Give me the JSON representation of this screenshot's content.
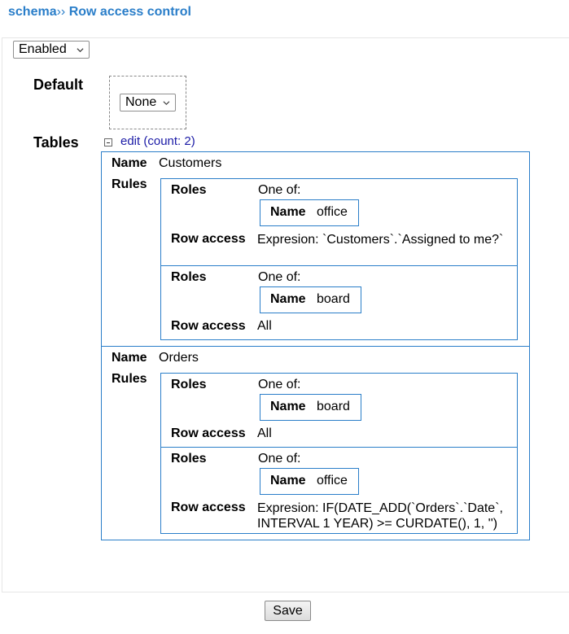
{
  "breadcrumb": {
    "root": "schema",
    "separator": "››",
    "current": "Row access control"
  },
  "status_select": {
    "value": "Enabled"
  },
  "default": {
    "label": "Default",
    "value": "None"
  },
  "tables": {
    "label": "Tables",
    "edit_label": "edit (count: 2)",
    "name_label": "Name",
    "rules_label": "Rules",
    "roles_label": "Roles",
    "row_access_label": "Row access",
    "one_of": "One of:",
    "items": [
      {
        "name": "Customers",
        "rules": [
          {
            "role_name": "office",
            "row_access": "Expresion: `Customers`.`Assigned to me?`"
          },
          {
            "role_name": "board",
            "row_access": "All"
          }
        ]
      },
      {
        "name": "Orders",
        "rules": [
          {
            "role_name": "board",
            "row_access": "All"
          },
          {
            "role_name": "office",
            "row_access": "Expresion: IF(DATE_ADD(`Orders`.`Date`, INTERVAL 1 YEAR) >= CURDATE(), 1, '')"
          }
        ]
      }
    ]
  },
  "save_label": "Save"
}
